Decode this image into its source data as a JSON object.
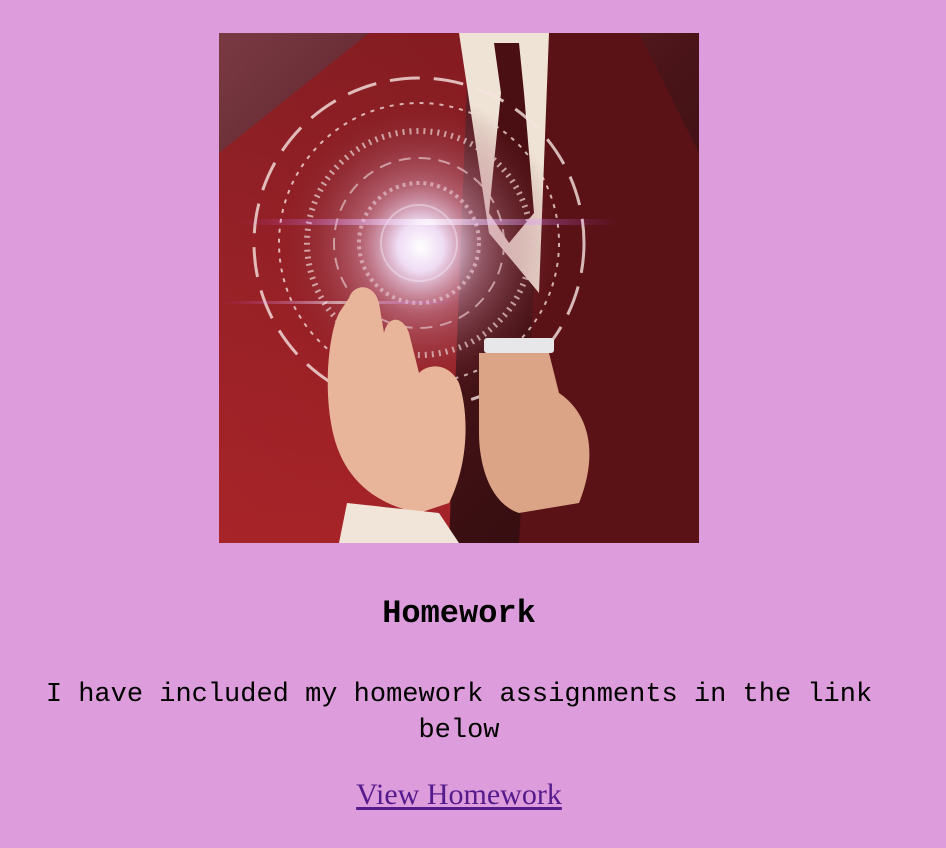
{
  "page": {
    "background": "#dd9cdc"
  },
  "hero_image": {
    "subject": "businessman-touching-holographic-interface",
    "dominant_colors": [
      "#5b1a1e",
      "#b01e25",
      "#f3e6da"
    ]
  },
  "section": {
    "title": "Homework",
    "description": "I have included my homework assignments in the link below",
    "link_label": "View Homework",
    "link_color": "#551a8b"
  }
}
